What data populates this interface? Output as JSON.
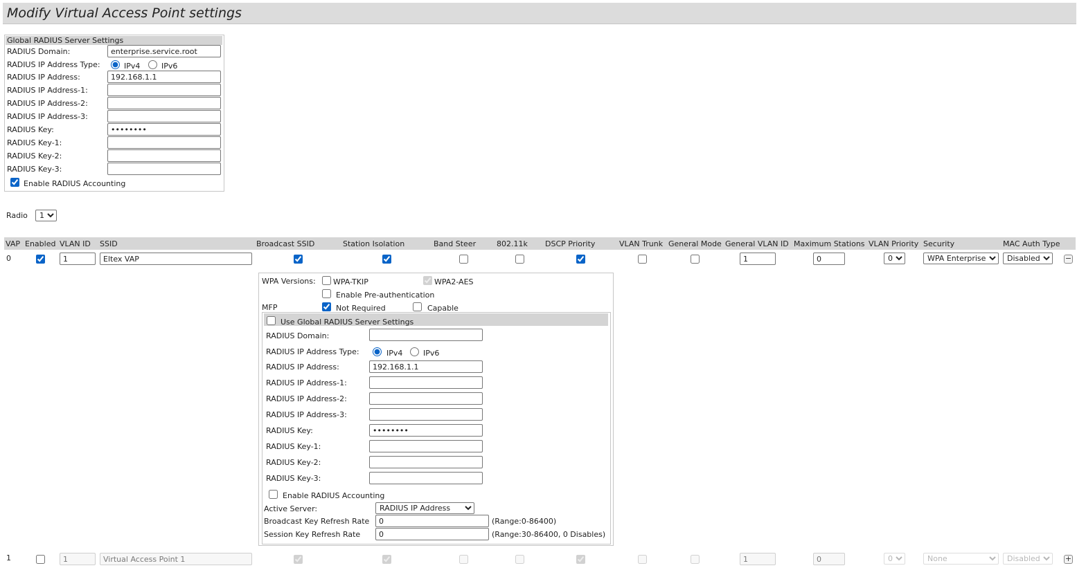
{
  "page_title": "Modify Virtual Access Point settings",
  "global_radius": {
    "header": "Global RADIUS Server Settings",
    "domain_label": "RADIUS Domain:",
    "domain_value": "enterprise.service.root",
    "ip_type_label": "RADIUS IP Address Type:",
    "ipv4_label": "IPv4",
    "ipv6_label": "IPv6",
    "ip_type_selected": "IPv4",
    "ip_label": "RADIUS IP Address:",
    "ip_value": "192.168.1.1",
    "ip1_label": "RADIUS IP Address-1:",
    "ip2_label": "RADIUS IP Address-2:",
    "ip3_label": "RADIUS IP Address-3:",
    "key_label": "RADIUS Key:",
    "key_value": "••••••••",
    "key1_label": "RADIUS Key-1:",
    "key2_label": "RADIUS Key-2:",
    "key3_label": "RADIUS Key-3:",
    "accounting_label": "Enable RADIUS Accounting",
    "accounting_checked": true
  },
  "radio": {
    "label": "Radio",
    "value": "1"
  },
  "table_headers": [
    "VAP",
    "Enabled",
    "VLAN ID",
    "SSID",
    "Broadcast SSID",
    "Station Isolation",
    "Band Steer",
    "802.11k",
    "DSCP Priority",
    "VLAN Trunk",
    "General Mode",
    "General VLAN ID",
    "Maximum Stations",
    "VLAN Priority",
    "Security",
    "MAC Auth Type"
  ],
  "vap_rows": [
    {
      "vap": "0",
      "enabled": true,
      "vlan_id": "1",
      "ssid": "Eltex VAP",
      "broadcast_ssid": true,
      "station_isolation": true,
      "band_steer": false,
      "k80211": false,
      "dscp_priority": true,
      "vlan_trunk": false,
      "general_mode": false,
      "general_vlan_id": "1",
      "max_stations": "0",
      "vlan_priority": "0",
      "security": "WPA Enterprise",
      "mac_auth": "Disabled",
      "toggle": "−",
      "active": true
    },
    {
      "vap": "1",
      "enabled": false,
      "vlan_id": "1",
      "ssid": "Virtual Access Point 1",
      "broadcast_ssid": true,
      "station_isolation": true,
      "band_steer": false,
      "k80211": false,
      "dscp_priority": true,
      "vlan_trunk": false,
      "general_mode": false,
      "general_vlan_id": "1",
      "max_stations": "0",
      "vlan_priority": "0",
      "security": "None",
      "mac_auth": "Disabled",
      "toggle": "+",
      "active": false
    }
  ],
  "wpa": {
    "versions_label": "WPA Versions:",
    "tkip_label": "WPA-TKIP",
    "tkip_checked": false,
    "aes_label": "WPA2-AES",
    "aes_checked": true,
    "preauth_label": "Enable Pre-authentication",
    "preauth_checked": false,
    "mfp_label": "MFP",
    "not_required_label": "Not Required",
    "not_required_checked": true,
    "capable_label": "Capable",
    "capable_checked": false
  },
  "vap_radius": {
    "use_global_label": "Use Global RADIUS Server Settings",
    "use_global_checked": false,
    "domain_label": "RADIUS Domain:",
    "domain_value": "",
    "ip_type_label": "RADIUS IP Address Type:",
    "ipv4_label": "IPv4",
    "ipv6_label": "IPv6",
    "ip_label": "RADIUS IP Address:",
    "ip_value": "192.168.1.1",
    "ip1_label": "RADIUS IP Address-1:",
    "ip2_label": "RADIUS IP Address-2:",
    "ip3_label": "RADIUS IP Address-3:",
    "key_label": "RADIUS Key:",
    "key_value": "••••••••",
    "key1_label": "RADIUS Key-1:",
    "key2_label": "RADIUS Key-2:",
    "key3_label": "RADIUS Key-3:",
    "accounting_label": "Enable RADIUS Accounting",
    "accounting_checked": false,
    "active_server_label": "Active Server:",
    "active_server_value": "RADIUS IP Address",
    "bcast_refresh_label": "Broadcast Key Refresh Rate",
    "bcast_refresh_value": "0",
    "bcast_refresh_range": "(Range:0-86400)",
    "session_refresh_label": "Session Key Refresh Rate",
    "session_refresh_value": "0",
    "session_refresh_range": "(Range:30-86400, 0 Disables)"
  }
}
